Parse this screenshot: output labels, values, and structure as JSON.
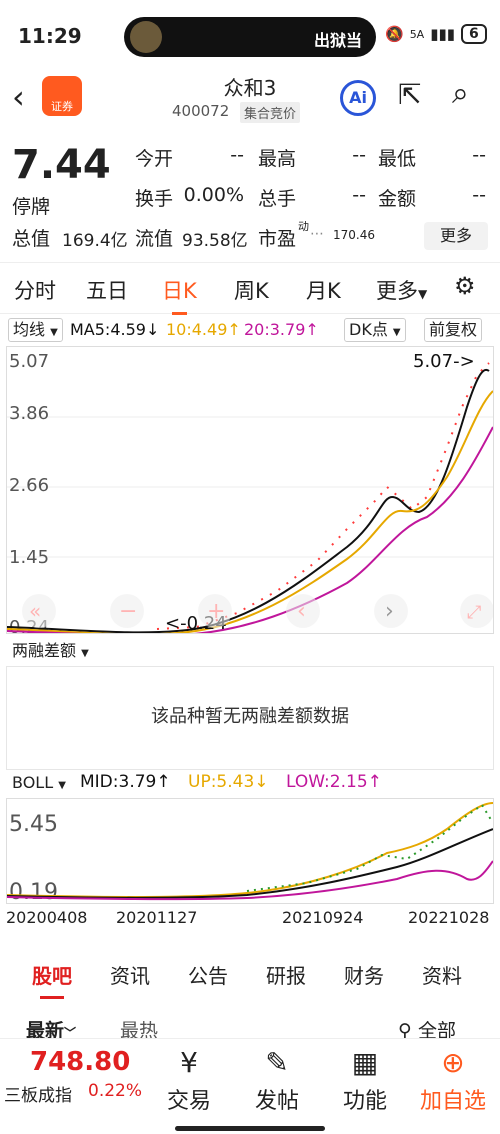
{
  "status": {
    "time": "11:29",
    "pill_text": "出狱当",
    "signal": "5A",
    "battery": "6"
  },
  "header": {
    "name": "众和3",
    "code": "400072",
    "auction": "集合竞价"
  },
  "quote": {
    "price": "7.44",
    "state": "停牌",
    "open_label": "今开",
    "open": "--",
    "high_label": "最高",
    "high": "--",
    "low_label": "最低",
    "low": "--",
    "turnover_label": "换手",
    "turnover": "0.00%",
    "volume_label": "总手",
    "volume": "--",
    "amount_label": "金额",
    "amount": "--",
    "total_cap_label": "总值",
    "total_cap": "169.4亿",
    "float_cap_label": "流值",
    "float_cap": "93.58亿",
    "pe_label": "市盈",
    "pe_sup": "动",
    "pe": "170.46",
    "more": "更多"
  },
  "ktabs": [
    "分时",
    "五日",
    "日K",
    "周K",
    "月K",
    "更多"
  ],
  "ma": {
    "selector": "均线",
    "ma5": "MA5:4.59",
    "ma10": "10:4.49",
    "ma20": "20:3.79",
    "dk": "DK点",
    "adj": "前复权",
    "colors": {
      "ma5": "#111111",
      "ma10": "#e6a800",
      "ma20": "#c0169b"
    }
  },
  "kchart": {
    "ticks": [
      "5.07",
      "3.86",
      "2.66",
      "1.45",
      "0.24"
    ],
    "max_label": "5.07->",
    "min_label": "<-0.24"
  },
  "margin": {
    "selector": "两融差额",
    "empty": "该品种暂无两融差额数据"
  },
  "boll": {
    "selector": "BOLL",
    "mid": "MID:3.79",
    "up": "UP:5.43",
    "low": "LOW:2.15",
    "top": "5.45",
    "bottom": "0.19"
  },
  "dates": [
    "20200408",
    "20201127",
    "20210924",
    "20221028"
  ],
  "news_tabs": [
    "股吧",
    "资讯",
    "公告",
    "研报",
    "财务",
    "资料"
  ],
  "sort": {
    "newest": "最新",
    "hottest": "最热",
    "all": "全部"
  },
  "bottom": {
    "index_value": "748.80",
    "index_name": "三板成指",
    "index_change": "0.22%",
    "buttons": [
      "交易",
      "发帖",
      "功能",
      "加自选"
    ]
  }
}
